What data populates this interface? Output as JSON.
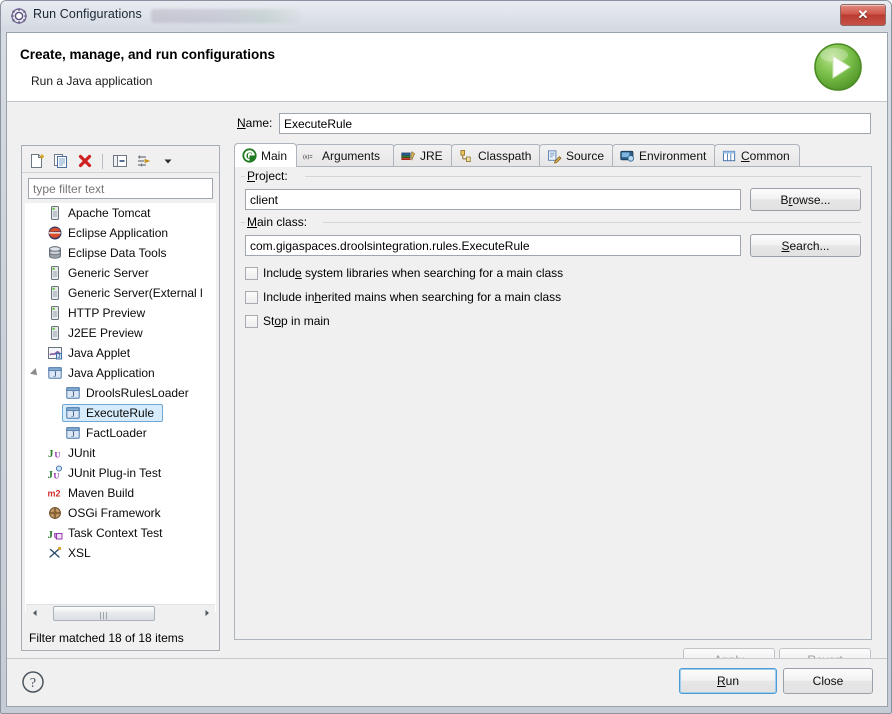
{
  "window": {
    "title": "Run Configurations",
    "title_icon": "run-configurations-icon",
    "close_glyph": "✕"
  },
  "banner": {
    "title": "Create, manage, and run configurations",
    "subtitle": "Run a Java application",
    "icon": "run-green-arrow-icon"
  },
  "toolbar": {
    "buttons": [
      {
        "name": "new-launch-configuration-icon",
        "title": "New launch configuration"
      },
      {
        "name": "duplicate-icon",
        "title": "Duplicates the currently selected launch configuration"
      },
      {
        "name": "delete-icon",
        "title": "Delete the selected launch configuration(s)"
      },
      {
        "name": "collapse-all-icon",
        "title": "Collapse All"
      },
      {
        "name": "filter-icon",
        "title": "Filter launch configurations"
      },
      {
        "name": "view-menu-chevron-down-icon",
        "title": "View Menu"
      }
    ]
  },
  "filter": {
    "placeholder": "type filter text",
    "value": "",
    "status": "Filter matched 18 of 18 items"
  },
  "tree": {
    "items": [
      {
        "label": "Apache Tomcat",
        "icon": "server-icon",
        "level": 0,
        "selected": false,
        "expandable": false
      },
      {
        "label": "Eclipse Application",
        "icon": "eclipse-icon",
        "level": 0,
        "selected": false,
        "expandable": false
      },
      {
        "label": "Eclipse Data Tools",
        "icon": "database-icon",
        "level": 0,
        "selected": false,
        "expandable": false
      },
      {
        "label": "Generic Server",
        "icon": "server-icon",
        "level": 0,
        "selected": false,
        "expandable": false
      },
      {
        "label": "Generic Server(External l",
        "icon": "server-icon",
        "level": 0,
        "selected": false,
        "expandable": false
      },
      {
        "label": "HTTP Preview",
        "icon": "server-icon",
        "level": 0,
        "selected": false,
        "expandable": false
      },
      {
        "label": "J2EE Preview",
        "icon": "server-icon",
        "level": 0,
        "selected": false,
        "expandable": false
      },
      {
        "label": "Java Applet",
        "icon": "java-applet-icon",
        "level": 0,
        "selected": false,
        "expandable": false
      },
      {
        "label": "Java Application",
        "icon": "java-application-icon",
        "level": 0,
        "selected": false,
        "expandable": true
      },
      {
        "label": "DroolsRulesLoader",
        "icon": "java-application-icon",
        "level": 1,
        "selected": false,
        "expandable": false
      },
      {
        "label": "ExecuteRule",
        "icon": "java-application-icon",
        "level": 1,
        "selected": true,
        "expandable": false
      },
      {
        "label": "FactLoader",
        "icon": "java-application-icon",
        "level": 1,
        "selected": false,
        "expandable": false
      },
      {
        "label": "JUnit",
        "icon": "junit-icon",
        "level": 0,
        "selected": false,
        "expandable": false
      },
      {
        "label": "JUnit Plug-in Test",
        "icon": "junit-plugin-icon",
        "level": 0,
        "selected": false,
        "expandable": false
      },
      {
        "label": "Maven Build",
        "icon": "maven-icon",
        "level": 0,
        "selected": false,
        "expandable": false
      },
      {
        "label": "OSGi Framework",
        "icon": "osgi-icon",
        "level": 0,
        "selected": false,
        "expandable": false
      },
      {
        "label": "Task Context Test",
        "icon": "task-context-test-icon",
        "level": 0,
        "selected": false,
        "expandable": false
      },
      {
        "label": "XSL",
        "icon": "xsl-icon",
        "level": 0,
        "selected": false,
        "expandable": false
      }
    ]
  },
  "config": {
    "name_label": "Name:",
    "name_mnemonic": "N",
    "name_value": "ExecuteRule"
  },
  "tabs": [
    {
      "label": "Main",
      "icon": "main-tab-icon",
      "active": true,
      "mnemonic": ""
    },
    {
      "label": "Arguments",
      "icon": "arguments-tab-icon",
      "active": false,
      "mnemonic": "g"
    },
    {
      "label": "JRE",
      "icon": "jre-tab-icon",
      "active": false,
      "mnemonic": ""
    },
    {
      "label": "Classpath",
      "icon": "classpath-tab-icon",
      "active": false,
      "mnemonic": ""
    },
    {
      "label": "Source",
      "icon": "source-tab-icon",
      "active": false,
      "mnemonic": ""
    },
    {
      "label": "Environment",
      "icon": "environment-tab-icon",
      "active": false,
      "mnemonic": ""
    },
    {
      "label": "Common",
      "icon": "common-tab-icon",
      "active": false,
      "mnemonic": "C"
    }
  ],
  "main_tab": {
    "project_label": "Project:",
    "project_value": "client",
    "browse_label": "Browse...",
    "main_class_label": "Main class:",
    "main_class_value": "com.gigaspaces.droolsintegration.rules.ExecuteRule",
    "search_label": "Search...",
    "checkboxes": [
      {
        "label": "Include system libraries when searching for a main class",
        "checked": false
      },
      {
        "label": "Include inherited mains when searching for a main class",
        "checked": false
      },
      {
        "label": "Stop in main",
        "checked": false
      }
    ]
  },
  "actions": {
    "apply_label": "Apply",
    "apply_enabled": false,
    "revert_label": "Revert",
    "revert_enabled": false
  },
  "footer": {
    "help_icon": "help-question-icon",
    "run_label": "Run",
    "close_label": "Close"
  },
  "colors": {
    "accent_blue": "#4b9bd4",
    "selection_fill": "#d6ebfb",
    "selection_border": "#6fa8d4",
    "run_green": "#5ea832",
    "close_red": "#c0392b",
    "dialog_bg": "#f0f0f0"
  }
}
